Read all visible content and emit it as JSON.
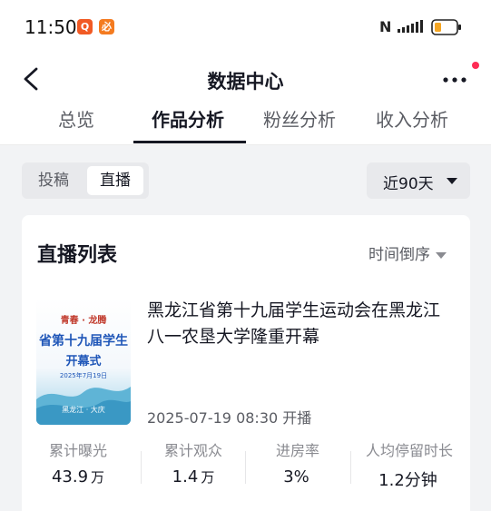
{
  "status_bar": {
    "time": "11:50",
    "app_badge_1": "Q",
    "app_badge_2": "必",
    "nfc": "N"
  },
  "header": {
    "title": "数据中心",
    "back_icon": "back-chevron-icon",
    "more_icon": "more-dots-icon"
  },
  "tabs": [
    {
      "label": "总览",
      "active": false
    },
    {
      "label": "作品分析",
      "active": true
    },
    {
      "label": "粉丝分析",
      "active": false
    },
    {
      "label": "收入分析",
      "active": false
    }
  ],
  "filter": {
    "segments": [
      {
        "label": "投稿",
        "active": false
      },
      {
        "label": "直播",
        "active": true
      }
    ],
    "range": "近90天"
  },
  "live_list": {
    "title": "直播列表",
    "sort": "时间倒序",
    "items": [
      {
        "title": "黑龙江省第十九届学生运动会在黑龙江八一农垦大学隆重开幕",
        "time": "2025-07-19 08:30 开播",
        "thumbnail": {
          "top_text": "青春 · 龙腾",
          "headline": "省第十九届学生",
          "subhead": "开幕式",
          "date": "2025年7月19日",
          "footer": "黑龙江 · 大庆"
        },
        "metrics": [
          {
            "label": "累计曝光",
            "value": "43.9",
            "unit": "万"
          },
          {
            "label": "累计观众",
            "value": "1.4",
            "unit": "万"
          },
          {
            "label": "进房率",
            "value": "3%",
            "unit": ""
          },
          {
            "label": "人均停留时长",
            "value": "1.2分钟",
            "unit": ""
          }
        ]
      }
    ]
  },
  "colors": {
    "accent_red": "#fe2c55",
    "text_primary": "#161823",
    "text_secondary": "#5a5c63",
    "background": "#f2f3f5"
  }
}
